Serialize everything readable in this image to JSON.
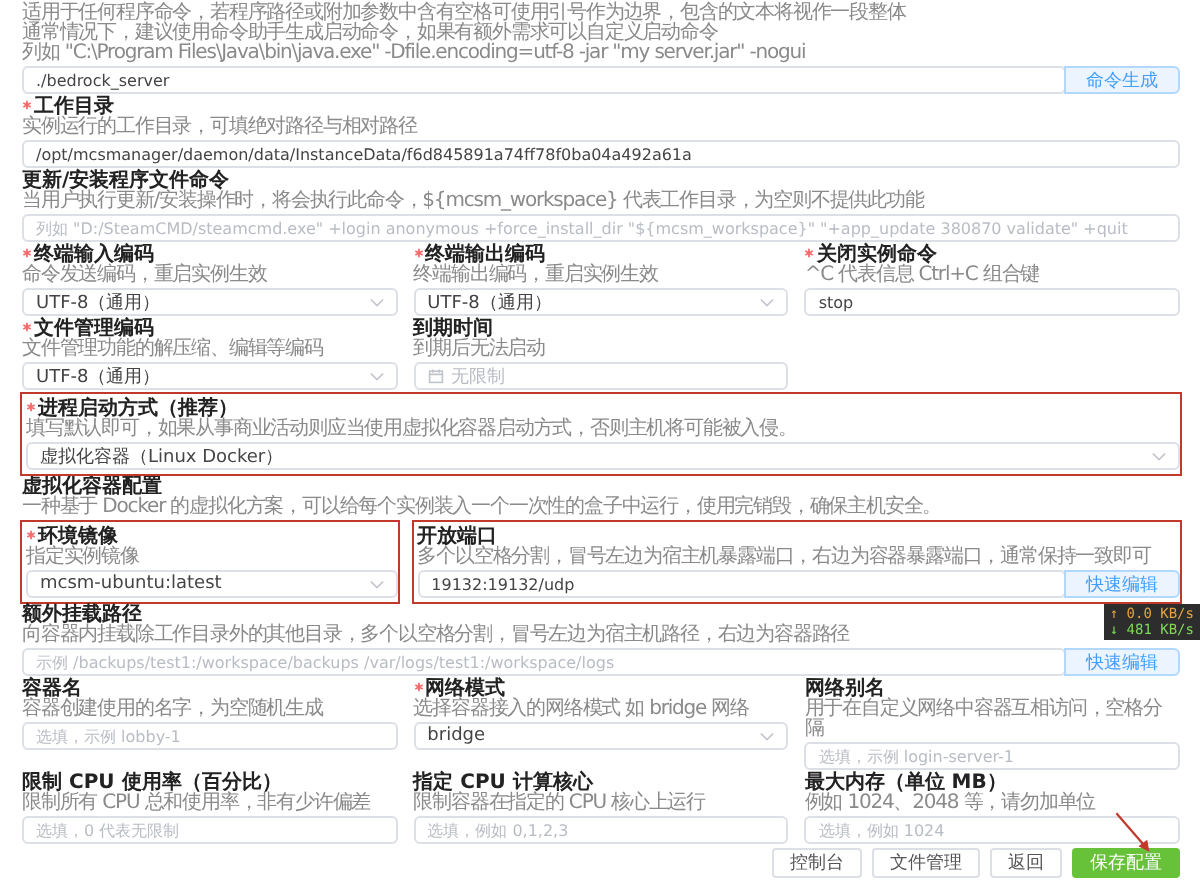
{
  "rows": [
    {
      "fields": [
        {
          "kind": "input",
          "required": false,
          "hint_lines": [
            "适用于任何程序命令，若程序路径或附加参数中含有空格可使用引号作为边界，包含的文本将视作一段整体",
            "通常情况下，建议使用命令助手生成启动命令，如果有额外需求可以自定义启动命令",
            "列如 \"C:\\Program Files\\Java\\bin\\java.exe\" -Dfile.encoding=utf-8 -jar \"my server.jar\" -nogui"
          ],
          "value": "./bedrock_server",
          "button": "命令生成",
          "highlighted": false
        }
      ]
    },
    {
      "fields": [
        {
          "kind": "input",
          "label": "工作目录",
          "required": true,
          "hint": "实例运行的工作目录，可填绝对路径与相对路径",
          "value": "/opt/mcsmanager/daemon/data/InstanceData/f6d845891a74ff78f0ba04a492a61a",
          "highlighted": false
        }
      ]
    },
    {
      "fields": [
        {
          "kind": "input",
          "label": "更新/安装程序文件命令",
          "required": false,
          "hint": "当用户执行更新/安装操作时，将会执行此命令，${mcsm_workspace} 代表工作目录，为空则不提供此功能",
          "placeholder": "列如 \"D:/SteamCMD/steamcmd.exe\" +login anonymous +force_install_dir \"${mcsm_workspace}\" \"+app_update 380870 validate\" +quit",
          "highlighted": false
        }
      ]
    },
    {
      "fields": [
        {
          "kind": "select",
          "label": "终端输入编码",
          "required": true,
          "hint": "命令发送编码，重启实例生效",
          "value": "UTF-8（通用）",
          "highlighted": false
        },
        {
          "kind": "select",
          "label": "终端输出编码",
          "required": true,
          "hint": "终端输出编码，重启实例生效",
          "value": "UTF-8（通用）",
          "highlighted": false
        },
        {
          "kind": "input",
          "label": "关闭实例命令",
          "required": true,
          "hint": "^C 代表信息 Ctrl+C 组合键",
          "value": "stop",
          "highlighted": false
        }
      ]
    },
    {
      "fields": [
        {
          "kind": "select",
          "label": "文件管理编码",
          "required": true,
          "hint": "文件管理功能的解压缩、编辑等编码",
          "value": "UTF-8（通用）",
          "highlighted": false
        },
        {
          "kind": "date",
          "label": "到期时间",
          "required": false,
          "hint": "到期后无法启动",
          "placeholder": "无限制",
          "highlighted": false
        }
      ]
    },
    {
      "fields": [
        {
          "kind": "select",
          "label": "进程启动方式（推荐）",
          "required": true,
          "hint": "填写默认即可，如果从事商业活动则应当使用虚拟化容器启动方式，否则主机将可能被入侵。",
          "value": "虚拟化容器（Linux Docker）",
          "highlighted": true
        }
      ]
    },
    {
      "section": {
        "title": "虚拟化容器配置",
        "hint": "一种基于 Docker 的虚拟化方案，可以给每个实例装入一个一次性的盒子中运行，使用完销毁，确保主机安全。"
      }
    },
    {
      "fields": [
        {
          "kind": "select",
          "label": "环境镜像",
          "required": true,
          "hint": "指定实例镜像",
          "value": "mcsm-ubuntu:latest",
          "highlighted": true
        },
        {
          "kind": "input",
          "label": "开放端口",
          "required": false,
          "hint": "多个以空格分割，冒号左边为宿主机暴露端口，右边为容器暴露端口，通常保持一致即可",
          "value": "19132:19132/udp",
          "button": "快速编辑",
          "highlighted": true
        }
      ]
    },
    {
      "net_speed": {
        "up": "↑ 0.0 KB/s",
        "down": "↓ 481 KB/s"
      },
      "fields": [
        {
          "kind": "input",
          "label": "额外挂载路径",
          "required": false,
          "hint": "向容器内挂载除工作目录外的其他目录，多个以空格分割，冒号左边为宿主机路径，右边为容器路径",
          "placeholder": "示例 /backups/test1:/workspace/backups /var/logs/test1:/workspace/logs",
          "button": "快速编辑",
          "highlighted": false
        }
      ]
    },
    {
      "fields": [
        {
          "kind": "input",
          "label": "容器名",
          "required": false,
          "hint": "容器创建使用的名字，为空随机生成",
          "placeholder": "选填，示例 lobby-1",
          "highlighted": false
        },
        {
          "kind": "select",
          "label": "网络模式",
          "required": true,
          "hint": "选择容器接入的网络模式 如 bridge 网络",
          "value": "bridge",
          "highlighted": false
        },
        {
          "kind": "input",
          "label": "网络别名",
          "required": false,
          "hint": "用于在自定义网络中容器互相访问，空格分隔",
          "placeholder": "选填，示例 login-server-1",
          "highlighted": false
        }
      ]
    },
    {
      "fields": [
        {
          "kind": "input",
          "label": "限制 CPU 使用率（百分比）",
          "required": false,
          "hint": "限制所有 CPU 总和使用率，非有少许偏差",
          "placeholder": "选填，0 代表无限制",
          "highlighted": false
        },
        {
          "kind": "input",
          "label": "指定 CPU 计算核心",
          "required": false,
          "hint": "限制容器在指定的 CPU 核心上运行",
          "placeholder": "选填，例如 0,1,2,3",
          "highlighted": false
        },
        {
          "kind": "input",
          "label": "最大内存（单位 MB）",
          "required": false,
          "hint": "例如 1024、2048 等，请勿加单位",
          "placeholder": "选填，例如 1024",
          "highlighted": false
        }
      ]
    }
  ],
  "actions": [
    {
      "label": "控制台",
      "primary": false,
      "arrow": false
    },
    {
      "label": "文件管理",
      "primary": false,
      "arrow": false
    },
    {
      "label": "返回",
      "primary": false,
      "arrow": false
    },
    {
      "label": "保存配置",
      "primary": true,
      "arrow": true
    }
  ]
}
